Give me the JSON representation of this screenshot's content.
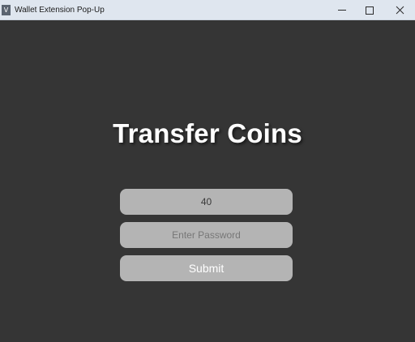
{
  "window": {
    "title": "Wallet Extension Pop-Up",
    "icon_letter": "V",
    "controls": [
      "minimize-icon",
      "maximize-icon",
      "close-icon"
    ]
  },
  "main": {
    "heading": "Transfer Coins",
    "amount_value": "40",
    "password_placeholder": "Enter Password",
    "submit_label": "Submit"
  },
  "colors": {
    "background": "#353535",
    "field": "#b4b4b4",
    "titlebar": "#dfe6ef"
  }
}
